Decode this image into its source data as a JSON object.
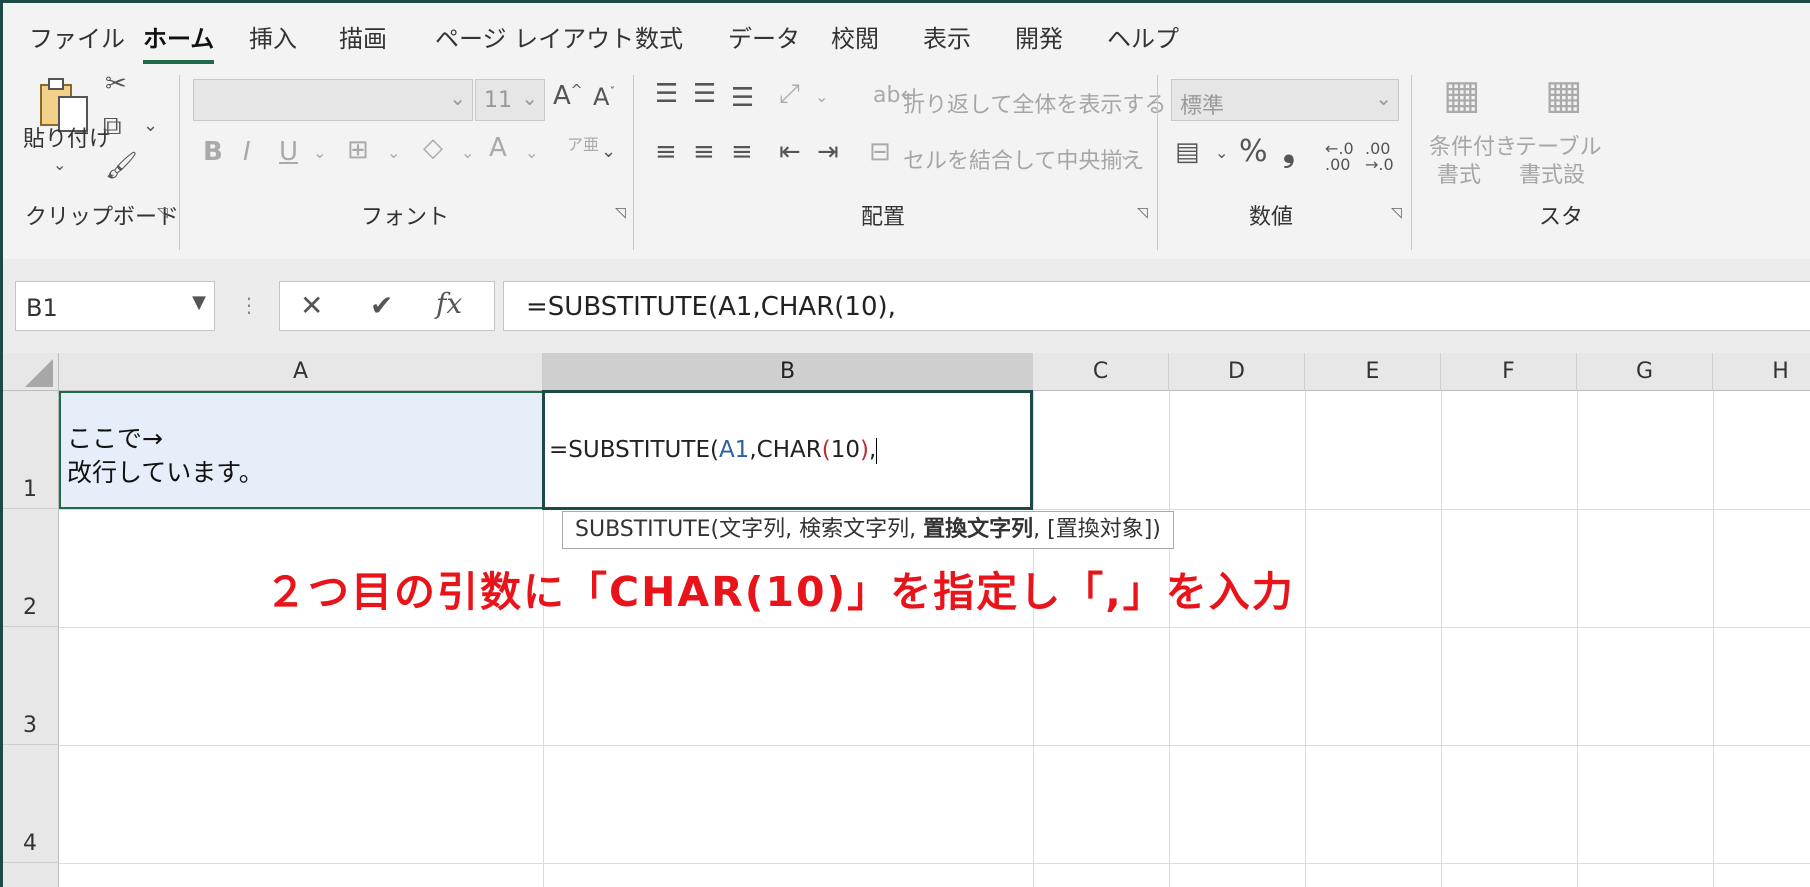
{
  "tabs": [
    "ファイル",
    "ホーム",
    "挿入",
    "描画",
    "ページ レイアウト",
    "数式",
    "データ",
    "校閲",
    "表示",
    "開発",
    "ヘルプ"
  ],
  "ribbon": {
    "clipboard": {
      "label": "クリップボード",
      "paste": "貼り付け"
    },
    "font": {
      "label": "フォント",
      "font_name": "",
      "font_size": "11",
      "bold": "B",
      "italic": "I",
      "underline": "U"
    },
    "alignment": {
      "label": "配置",
      "wrap_text": "折り返して全体を表示する",
      "merge_center": "セルを結合して中央揃え"
    },
    "number": {
      "label": "数値",
      "format": "標準",
      "percent": "%",
      "comma": "❟"
    },
    "styles": {
      "cond_format_line1": "条件付き",
      "cond_format_line2": "書式",
      "table_line1": "テーブル",
      "table_line2": "書式設",
      "label": "スタ"
    }
  },
  "formula_bar": {
    "name_box": "B1",
    "formula": "=SUBSTITUTE(A1,CHAR(10),"
  },
  "grid": {
    "columns": [
      "A",
      "B",
      "C",
      "D",
      "E",
      "F",
      "G",
      "H"
    ],
    "rows": [
      "1",
      "2",
      "3",
      "4"
    ],
    "A1_line1": "ここで→",
    "A1_line2": "改行しています。",
    "B1": {
      "p1": "=SUBSTITUTE(",
      "p2": "A1",
      "p3": ",CHAR",
      "p4": "(",
      "p5": "10",
      "p6": ")",
      "p7": ","
    },
    "tooltip": {
      "prefix": "SUBSTITUTE(文字列, 検索文字列, ",
      "current": "置換文字列",
      "suffix": ", [置換対象])"
    }
  },
  "annotation": "２つ目の引数に「CHAR(10)」を指定し「,」を入力",
  "colors": {
    "accent": "#1e6a4a",
    "annotation": "#e8141a",
    "ref_blue": "#2f5fa3",
    "paren_red": "#b5322e"
  }
}
